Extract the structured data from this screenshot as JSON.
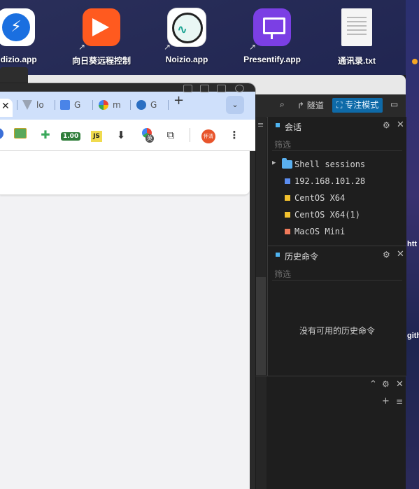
{
  "desktop": {
    "icons": [
      {
        "label": "ndizio.app",
        "color": "#1a6fe0"
      },
      {
        "label": "向日葵远程控制",
        "color": "#ff5a1f"
      },
      {
        "label": "Noizio.app",
        "color": "#ffffff"
      },
      {
        "label": "Presentify.app",
        "color": "#7b3fe4"
      },
      {
        "label": "通讯录.txt",
        "color": "#f5f5f5"
      }
    ],
    "right_strip": {
      "text_1": "htt",
      "text_2": "gith"
    }
  },
  "browser": {
    "tabs": [
      {
        "title": "lo"
      },
      {
        "title": "G"
      },
      {
        "title": "m"
      },
      {
        "title": "G"
      }
    ],
    "new_tab_label": "+",
    "extensions": {
      "badge_value": "1.00",
      "js_label": "JS",
      "translate_badge": "英",
      "avatar_text": "怀清"
    }
  },
  "terminal": {
    "toolbar": {
      "search_icon": "search-icon",
      "tunnel_label": "隧道",
      "focus_label": "专注模式"
    },
    "sessions_panel": {
      "title": "会话",
      "filter_placeholder": "筛选",
      "items": [
        {
          "name": "Shell sessions",
          "type": "folder"
        },
        {
          "name": "192.168.101.28",
          "color": "#5b8df0"
        },
        {
          "name": "CentOS X64",
          "color": "#f2c12e"
        },
        {
          "name": "CentOS X64(1)",
          "color": "#f2c12e"
        },
        {
          "name": "MacOS Mini",
          "color": "#f07a5a"
        }
      ]
    },
    "history_panel": {
      "title": "历史命令",
      "filter_placeholder": "筛选",
      "empty_text": "没有可用的历史命令"
    }
  }
}
